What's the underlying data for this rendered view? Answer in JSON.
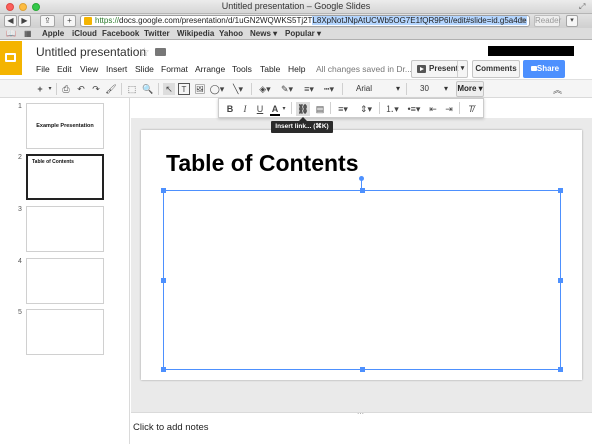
{
  "window": {
    "title": "Untitled presentation – Google Slides"
  },
  "browser": {
    "url_prefix": "https://",
    "url_plain": "docs.google.com/presentation/d/1uGN2WQWKS5Tj2T",
    "url_selected": "L8XpNotJNpAtUCWb5OG7E1fQR9P6I/edit#slide=id.g5a4de",
    "reader_label": "Reader",
    "bookmarks": [
      "Apple",
      "iCloud",
      "Facebook",
      "Twitter",
      "Wikipedia",
      "Yahoo",
      "News ▾",
      "Popular ▾"
    ]
  },
  "app": {
    "doc_title": "Untitled presentation",
    "menu": [
      "File",
      "Edit",
      "View",
      "Insert",
      "Slide",
      "Format",
      "Arrange",
      "Tools",
      "Table",
      "Help"
    ],
    "save_status": "All changes saved in Dr...",
    "present_label": "Present",
    "comments_label": "Comments",
    "share_label": "Share",
    "brand_color": "#f4b400",
    "accent_color": "#4d90fe"
  },
  "toolbar": {
    "font_name": "Arial",
    "font_size": "30",
    "more_label": "More"
  },
  "format_bar": {
    "bold": "B",
    "italic": "I",
    "underline": "U",
    "text_color": "A",
    "tooltip": "Insert link... (⌘K)"
  },
  "slides": [
    {
      "num": "1",
      "title": "Example Presentation"
    },
    {
      "num": "2",
      "title": "Table of Contents"
    },
    {
      "num": "3",
      "title": ""
    },
    {
      "num": "4",
      "title": ""
    },
    {
      "num": "5",
      "title": ""
    }
  ],
  "current_slide": {
    "title": "Table of Contents"
  },
  "notes": {
    "placeholder": "Click to add notes"
  }
}
